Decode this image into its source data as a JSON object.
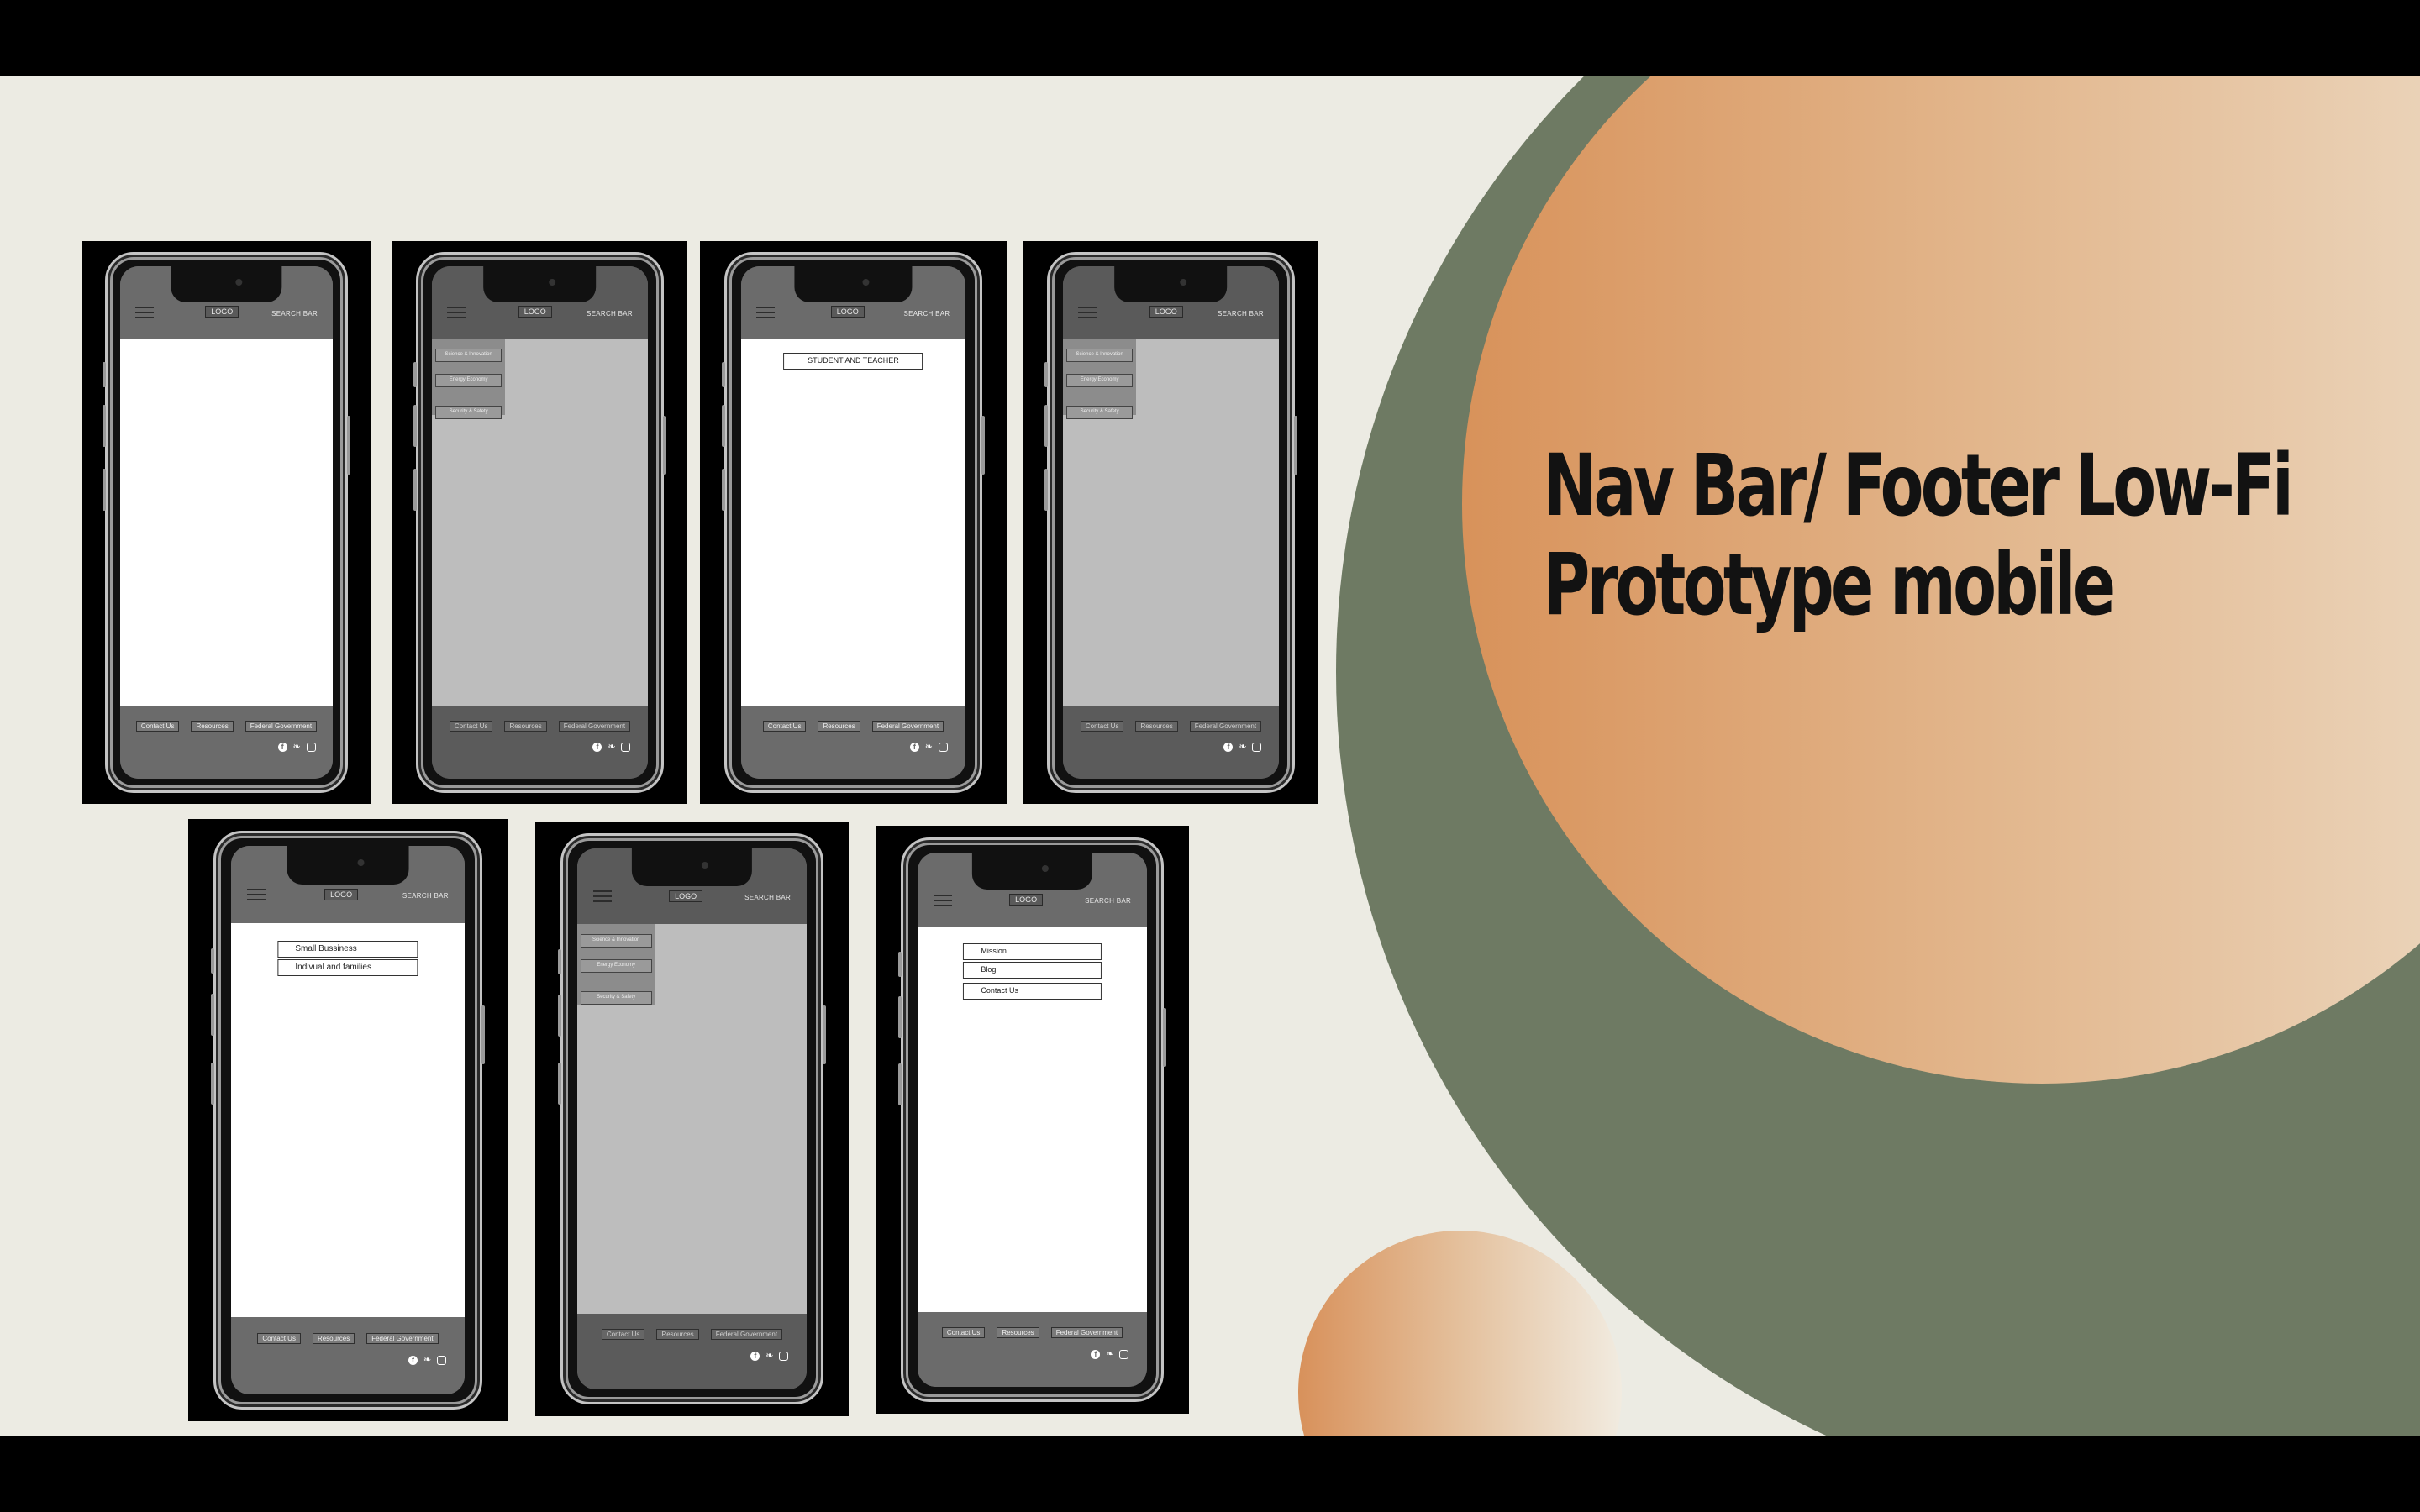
{
  "slide": {
    "title_line1": "Nav Bar/ Footer Low-Fi",
    "title_line2": "Prototype mobile"
  },
  "phone_common": {
    "logo": "LOGO",
    "search": "SEARCH BAR",
    "footer_links": [
      "Contact Us",
      "Resources",
      "Federal Government"
    ],
    "socials": [
      "facebook-icon",
      "twitter-icon",
      "instagram-icon"
    ]
  },
  "drawer_items": [
    "Science & Innovation",
    "Energy Economy",
    "Security & Safety"
  ],
  "phone3": {
    "button": "STUDENT AND TEACHER"
  },
  "phone5": {
    "buttons": [
      "Small Bussiness",
      "Indivual and families"
    ]
  },
  "phone7": {
    "buttons": [
      "Mission",
      "Blog",
      "Contact Us"
    ]
  },
  "colors": {
    "green": "#6e7a63",
    "orange": "#d8925a",
    "background": "#ecebe3"
  }
}
